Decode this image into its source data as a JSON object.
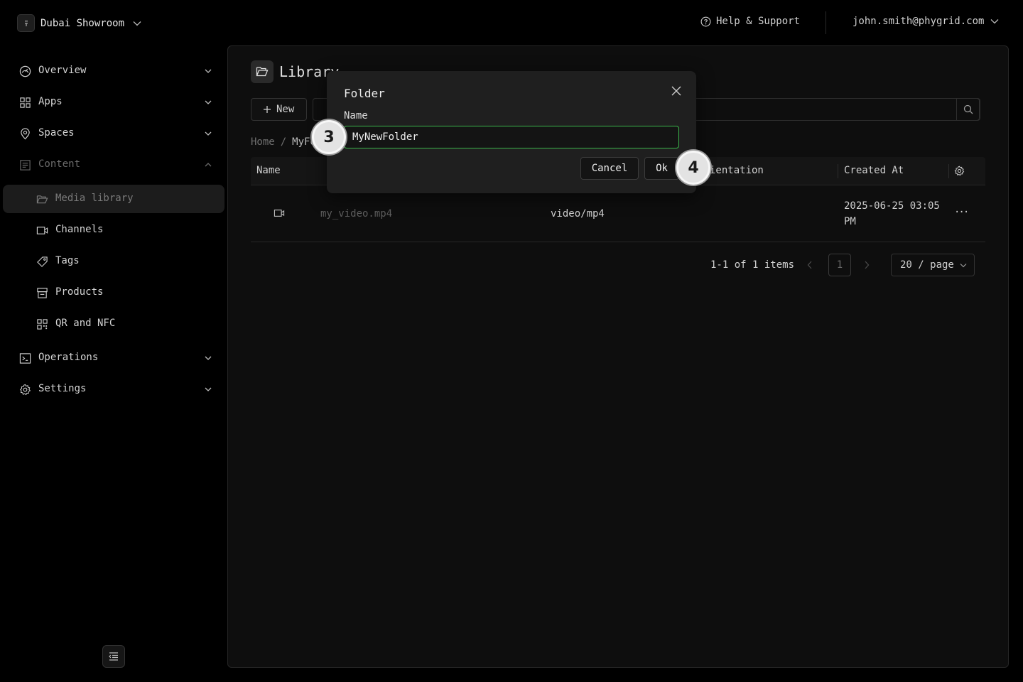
{
  "topbar": {
    "org_name": "Dubai Showroom",
    "help_label": "Help & Support",
    "user_email": "john.smith@phygrid.com"
  },
  "sidebar": {
    "items": [
      {
        "label": "Overview",
        "icon": "dashboard-icon"
      },
      {
        "label": "Apps",
        "icon": "apps-grid-icon"
      },
      {
        "label": "Spaces",
        "icon": "location-pin-icon"
      },
      {
        "label": "Content",
        "icon": "content-icon"
      },
      {
        "label": "Media library",
        "icon": "folder-open-icon"
      },
      {
        "label": "Channels",
        "icon": "video-camera-icon"
      },
      {
        "label": "Tags",
        "icon": "tag-icon"
      },
      {
        "label": "Products",
        "icon": "shop-icon"
      },
      {
        "label": "QR and NFC",
        "icon": "qrcode-icon"
      },
      {
        "label": "Operations",
        "icon": "terminal-icon"
      },
      {
        "label": "Settings",
        "icon": "gear-icon"
      }
    ]
  },
  "main": {
    "title": "Library",
    "new_label": "New",
    "breadcrumb": {
      "home": "Home",
      "sep": "/",
      "current": "MyFo"
    },
    "table": {
      "columns": {
        "name": "Name",
        "orientation": "ientation",
        "created": "Created At"
      },
      "rows": [
        {
          "name": "my_video.mp4",
          "type": "video/mp4",
          "created_line1": "2025-06-25 03:05",
          "created_line2": "PM",
          "actions": "···"
        }
      ]
    },
    "pagination": {
      "info": "1-1 of 1 items",
      "page": "1",
      "page_size": "20 / page"
    }
  },
  "modal": {
    "title": "Folder",
    "field_label": "Name",
    "field_value": "MyNewFolder",
    "cancel_label": "Cancel",
    "ok_label": "Ok"
  },
  "steps": {
    "first": "3",
    "second": "4"
  },
  "colors": {
    "accent_focus": "#3bb54a",
    "background": "#000000",
    "panel": "#0e0e0e"
  }
}
